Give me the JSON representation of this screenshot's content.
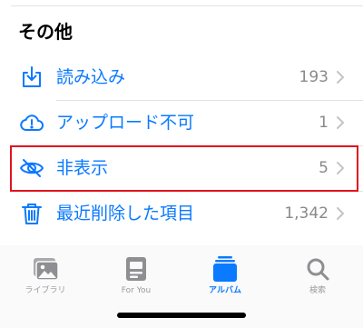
{
  "section": {
    "title": "その他"
  },
  "rows": [
    {
      "label": "読み込み",
      "count": "193",
      "icon": "import-icon"
    },
    {
      "label": "アップロード不可",
      "count": "1",
      "icon": "cloud-alert-icon"
    },
    {
      "label": "非表示",
      "count": "5",
      "icon": "eye-slash-icon",
      "highlighted": true
    },
    {
      "label": "最近削除した項目",
      "count": "1,342",
      "icon": "trash-icon"
    }
  ],
  "tabbar": {
    "tabs": [
      {
        "label": "ライブラリ",
        "icon": "photos-library-icon",
        "active": false
      },
      {
        "label": "For You",
        "icon": "for-you-icon",
        "active": false
      },
      {
        "label": "アルバム",
        "icon": "albums-icon",
        "active": true
      },
      {
        "label": "検索",
        "icon": "search-icon",
        "active": false
      }
    ]
  },
  "colors": {
    "accent": "#0a7aff",
    "highlight": "#e0141e",
    "secondary_text": "#8a8a8e"
  }
}
